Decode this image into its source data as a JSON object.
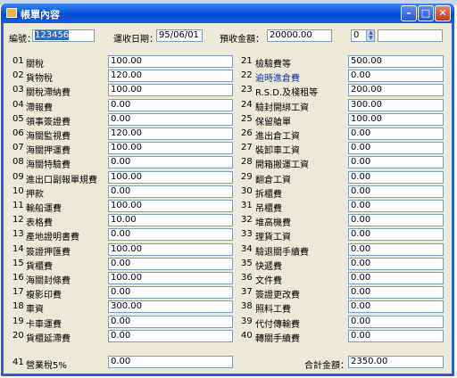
{
  "window": {
    "title": "帳單內容"
  },
  "header": {
    "number_label": "編號：",
    "number_value": "123456",
    "date_label": "運收日期：",
    "date_value": "95/06/01",
    "prepaid_label": "預收金額：",
    "prepaid_value": "20000.00",
    "spinner_value": "0"
  },
  "left_items": [
    {
      "code": "01",
      "label": "關稅",
      "value": "100.00"
    },
    {
      "code": "02",
      "label": "貨物稅",
      "value": "120.00"
    },
    {
      "code": "03",
      "label": "關稅滯納費",
      "value": "100.00"
    },
    {
      "code": "04",
      "label": "滯報費",
      "value": "0.00"
    },
    {
      "code": "05",
      "label": "領事簽證費",
      "value": "0.00"
    },
    {
      "code": "06",
      "label": "海關監視費",
      "value": "120.00"
    },
    {
      "code": "07",
      "label": "海關押運費",
      "value": "100.00"
    },
    {
      "code": "08",
      "label": "海關特驗費",
      "value": "0.00"
    },
    {
      "code": "09",
      "label": "進出口副報單規費",
      "value": "100.00"
    },
    {
      "code": "10",
      "label": "押款",
      "value": "0.00"
    },
    {
      "code": "11",
      "label": "輸船運費",
      "value": "100.00"
    },
    {
      "code": "12",
      "label": "表格費",
      "value": "10.00"
    },
    {
      "code": "13",
      "label": "產地證明書費",
      "value": "0.00"
    },
    {
      "code": "14",
      "label": "簽證押匯費",
      "value": "100.00"
    },
    {
      "code": "15",
      "label": "貨櫃費",
      "value": "0.00"
    },
    {
      "code": "16",
      "label": "海關封條費",
      "value": "100.00"
    },
    {
      "code": "17",
      "label": "複影印費",
      "value": "0.00"
    },
    {
      "code": "18",
      "label": "車資",
      "value": "300.00"
    },
    {
      "code": "19",
      "label": "卡車運費",
      "value": "0.00"
    },
    {
      "code": "20",
      "label": "貨櫃延滯費",
      "value": "0.00"
    }
  ],
  "right_items": [
    {
      "code": "21",
      "label": "檢驗費等",
      "value": "500.00",
      "highlight": false
    },
    {
      "code": "22",
      "label": "逾時進倉費",
      "value": "0.00",
      "highlight": true
    },
    {
      "code": "23",
      "label": "R.S.D.及棧租等",
      "value": "200.00",
      "highlight": false
    },
    {
      "code": "24",
      "label": "驗封開綁工資",
      "value": "300.00",
      "highlight": false
    },
    {
      "code": "25",
      "label": "保留艙單",
      "value": "100.00",
      "highlight": false
    },
    {
      "code": "26",
      "label": "進出倉工資",
      "value": "0.00",
      "highlight": false
    },
    {
      "code": "27",
      "label": "裝卸車工資",
      "value": "0.00",
      "highlight": false
    },
    {
      "code": "28",
      "label": "開箱搬運工資",
      "value": "0.00",
      "highlight": false
    },
    {
      "code": "29",
      "label": "翻倉工資",
      "value": "0.00",
      "highlight": false
    },
    {
      "code": "30",
      "label": "拆櫃費",
      "value": "0.00",
      "highlight": false
    },
    {
      "code": "31",
      "label": "吊櫃費",
      "value": "0.00",
      "highlight": false
    },
    {
      "code": "32",
      "label": "堆高機費",
      "value": "0.00",
      "highlight": false
    },
    {
      "code": "33",
      "label": "理貨工資",
      "value": "0.00",
      "highlight": false
    },
    {
      "code": "34",
      "label": "驗退關手續費",
      "value": "0.00",
      "highlight": false
    },
    {
      "code": "35",
      "label": "快遞費",
      "value": "0.00",
      "highlight": false
    },
    {
      "code": "36",
      "label": "文件費",
      "value": "0.00",
      "highlight": false
    },
    {
      "code": "37",
      "label": "簽證更改費",
      "value": "0.00",
      "highlight": false
    },
    {
      "code": "38",
      "label": "照料工費",
      "value": "0.00",
      "highlight": false
    },
    {
      "code": "39",
      "label": "代付傳輸費",
      "value": "0.00",
      "highlight": false
    },
    {
      "code": "40",
      "label": "轉關手續費",
      "value": "0.00",
      "highlight": false
    }
  ],
  "footer": {
    "tax_code": "41",
    "tax_label": "營業稅5%",
    "tax_value": "0.00",
    "total_label": "合計金額：",
    "total_value": "2350.00"
  },
  "colors": {
    "highlight_label": "#1a32a6",
    "titlebar": "#0a5ae0",
    "client_bg": "#ece9d8"
  }
}
